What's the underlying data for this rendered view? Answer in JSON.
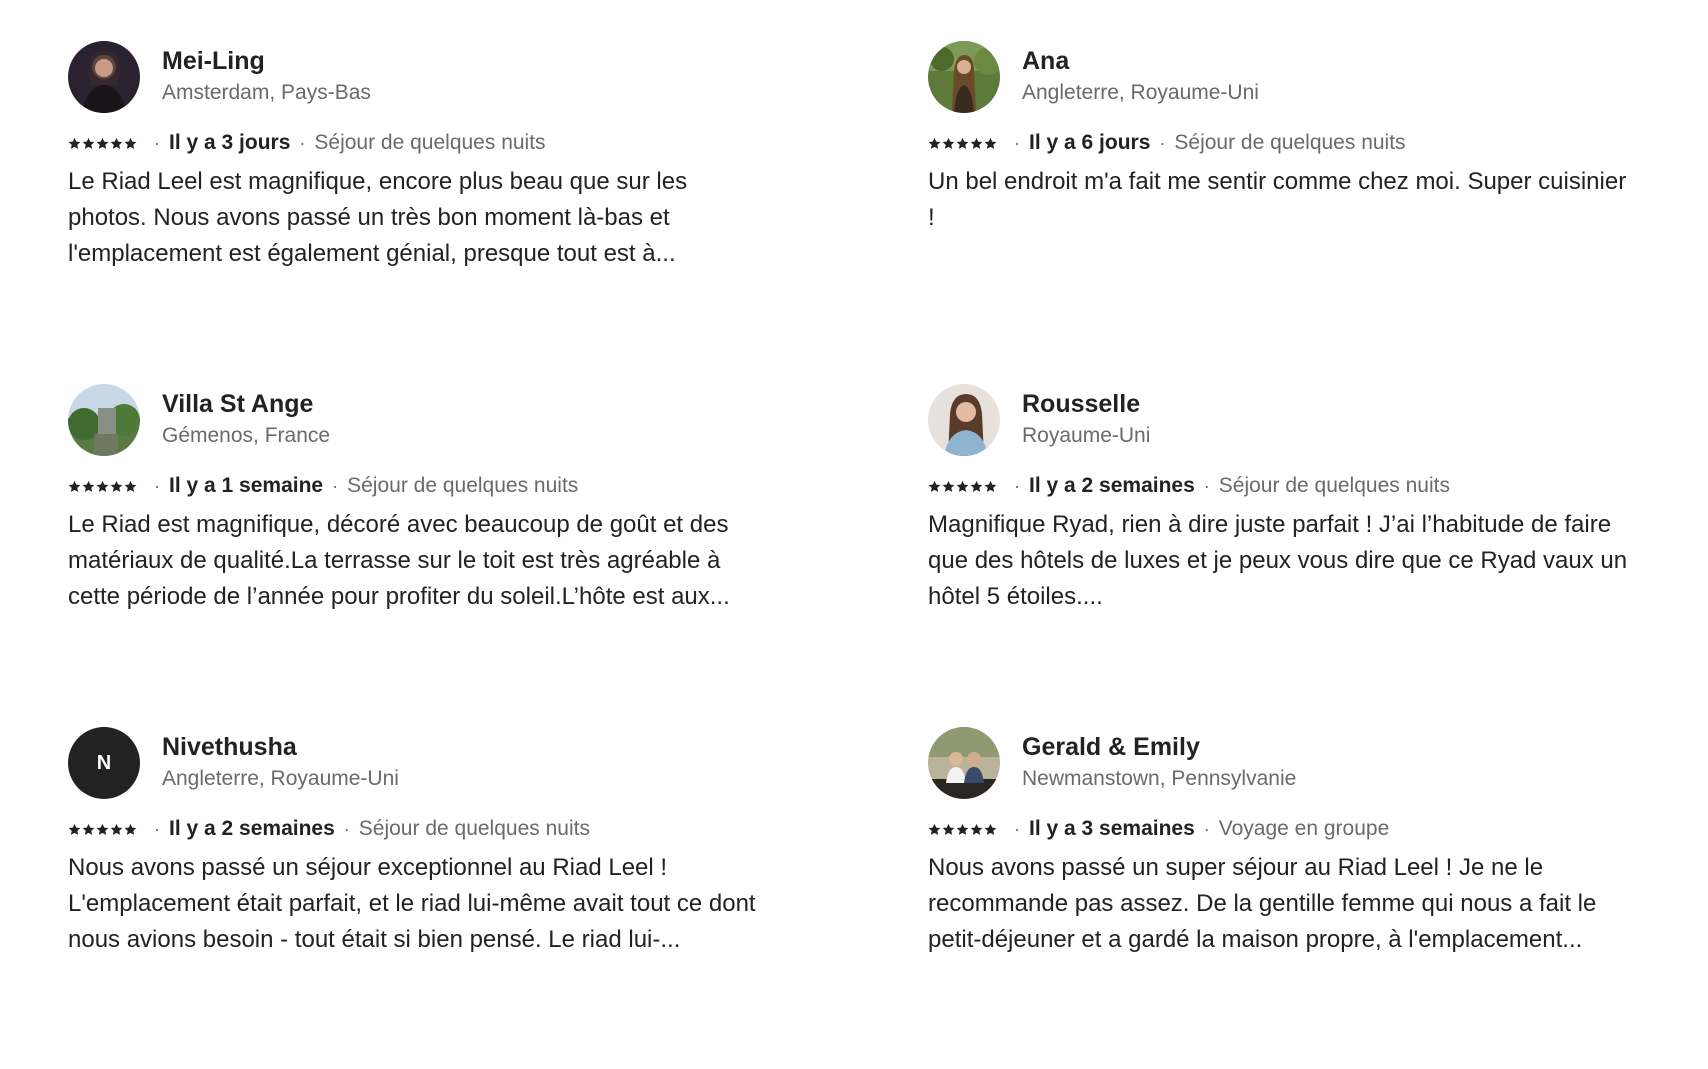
{
  "reviews": [
    {
      "name": "Mei-Ling",
      "location": "Amsterdam, Pays-Bas",
      "rating": 5,
      "when": "Il y a 3 jours",
      "stay": "Séjour de quelques nuits",
      "text": "Le Riad Leel est magnifique, encore plus beau que sur les photos. Nous avons passé un très bon moment là-bas et l'emplacement est également génial, presque tout est à..."
    },
    {
      "name": "Ana",
      "location": "Angleterre, Royaume-Uni",
      "rating": 5,
      "when": "Il y a 6 jours",
      "stay": "Séjour de quelques nuits",
      "text": "Un bel endroit m'a fait me sentir comme chez moi. Super cuisinier !"
    },
    {
      "name": "Villa St Ange",
      "location": "Gémenos, France",
      "rating": 5,
      "when": "Il y a 1 semaine",
      "stay": "Séjour de quelques nuits",
      "text": "Le Riad est magnifique, décoré avec beaucoup de goût et des matériaux de qualité.La terrasse sur le toit est très agréable à cette période de l’année pour profiter du soleil.L’hôte est aux..."
    },
    {
      "name": "Rousselle",
      "location": "Royaume-Uni",
      "rating": 5,
      "when": "Il y a 2 semaines",
      "stay": "Séjour de quelques nuits",
      "text": "Magnifique Ryad, rien à dire juste parfait ! J’ai l’habitude de faire que des hôtels de luxes et je peux vous dire que ce Ryad vaux un hôtel 5 étoiles...."
    },
    {
      "name": "Nivethusha",
      "location": "Angleterre, Royaume-Uni",
      "rating": 5,
      "initial": "N",
      "when": "Il y a 2 semaines",
      "stay": "Séjour de quelques nuits",
      "text": "Nous avons passé un séjour exceptionnel au Riad Leel ! L'emplacement était parfait, et le riad lui-même avait tout ce dont nous avions besoin - tout était si bien pensé. Le riad lui-..."
    },
    {
      "name": "Gerald & Emily",
      "location": "Newmanstown, Pennsylvanie",
      "rating": 5,
      "when": "Il y a 3 semaines",
      "stay": "Voyage en groupe",
      "text": "Nous avons passé un super séjour au Riad Leel ! Je ne le recommande pas assez. De la gentille femme qui nous a fait le petit-déjeuner et a gardé la maison propre, à l'emplacement..."
    }
  ],
  "separator": "·",
  "icons": {
    "star": "star-icon"
  },
  "colors": {
    "text": "#222222",
    "muted": "#6a6a6a",
    "avatar_initial_bg": "#222222"
  }
}
